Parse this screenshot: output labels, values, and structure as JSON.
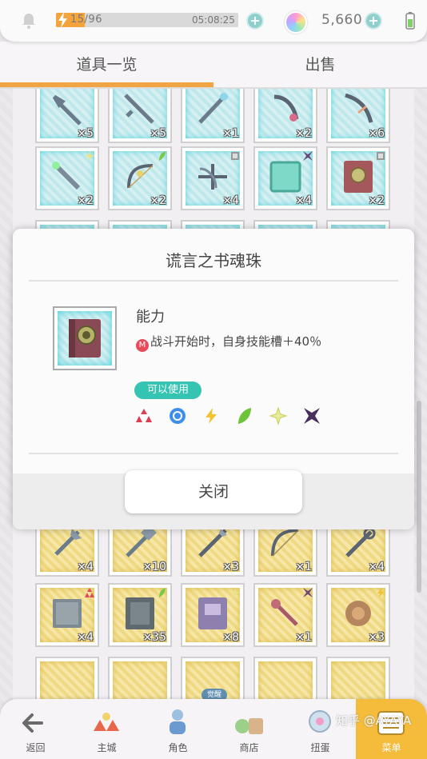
{
  "status": {
    "stamina_text": "15/96",
    "stamina_fraction": 0.16,
    "timer": "05:08:25",
    "gem_count": "5,660"
  },
  "tabs": {
    "items": "道具一览",
    "sell": "出售"
  },
  "grid": {
    "row1_qty": [
      "×5",
      "×5",
      "×1",
      "×2",
      "×6"
    ],
    "row2_qty": [
      "×2",
      "×2",
      "×4",
      "×4",
      "×2"
    ],
    "row3_qty": [
      "×4",
      "×10",
      "×3",
      "×1",
      "×4"
    ],
    "row4_qty": [
      "×4",
      "×35",
      "×8",
      "×1",
      "×3"
    ],
    "badge_label": "觉醒"
  },
  "modal": {
    "title": "谎言之书魂珠",
    "ability_heading": "能力",
    "ability_icon": "M",
    "ability_text": "战斗开始时，自身技能槽＋40％",
    "usable_label": "可以使用",
    "elements": [
      "fire",
      "water",
      "thunder",
      "wind",
      "light",
      "dark"
    ],
    "close_label": "关闭"
  },
  "nav": {
    "items": [
      "返回",
      "主城",
      "角色",
      "商店",
      "扭蛋",
      "菜单"
    ]
  },
  "watermark": "知乎 @AYAYA",
  "colors": {
    "accent": "#f0a443",
    "teal_glow": "#56d4dd",
    "gold_glow": "#e0b94a",
    "usable_badge": "#35c3b2"
  }
}
